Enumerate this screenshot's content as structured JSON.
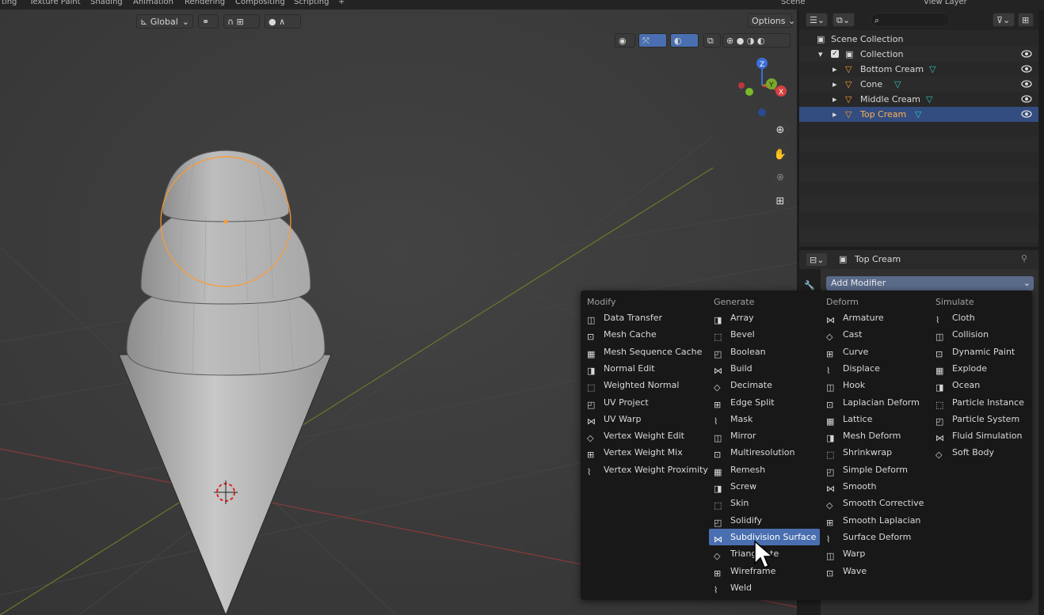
{
  "workspace_tabs": [
    "ting",
    "Texture Paint",
    "Shading",
    "Animation",
    "Rendering",
    "Compositing",
    "Scripting",
    "+"
  ],
  "top_right": {
    "scene": "Scene",
    "view_layer": "View Layer"
  },
  "viewport_header": {
    "transform_orientation": "Global",
    "options_label": "Options"
  },
  "gizmo_axes": {
    "z": "Z",
    "y": "Y",
    "x": "X"
  },
  "outliner": {
    "scene_collection": "Scene Collection",
    "collection": "Collection",
    "objects": [
      {
        "label": "Bottom Cream",
        "selected": false
      },
      {
        "label": "Cone",
        "selected": false
      },
      {
        "label": "Middle Cream",
        "selected": false
      },
      {
        "label": "Top Cream",
        "selected": true
      }
    ]
  },
  "properties": {
    "object_name": "Top Cream",
    "add_modifier": "Add Modifier"
  },
  "modifier_menu": {
    "columns": [
      {
        "heading": "Modify",
        "items": [
          "Data Transfer",
          "Mesh Cache",
          "Mesh Sequence Cache",
          "Normal Edit",
          "Weighted Normal",
          "UV Project",
          "UV Warp",
          "Vertex Weight Edit",
          "Vertex Weight Mix",
          "Vertex Weight Proximity"
        ]
      },
      {
        "heading": "Generate",
        "items": [
          "Array",
          "Bevel",
          "Boolean",
          "Build",
          "Decimate",
          "Edge Split",
          "Mask",
          "Mirror",
          "Multiresolution",
          "Remesh",
          "Screw",
          "Skin",
          "Solidify",
          "Subdivision Surface",
          "Triangulate",
          "Wireframe",
          "Weld"
        ]
      },
      {
        "heading": "Deform",
        "items": [
          "Armature",
          "Cast",
          "Curve",
          "Displace",
          "Hook",
          "Laplacian Deform",
          "Lattice",
          "Mesh Deform",
          "Shrinkwrap",
          "Simple Deform",
          "Smooth",
          "Smooth Corrective",
          "Smooth Laplacian",
          "Surface Deform",
          "Warp",
          "Wave"
        ]
      },
      {
        "heading": "Simulate",
        "items": [
          "Cloth",
          "Collision",
          "Dynamic Paint",
          "Explode",
          "Ocean",
          "Particle Instance",
          "Particle System",
          "Fluid Simulation",
          "Soft Body"
        ]
      }
    ],
    "highlighted": "Subdivision Surface"
  },
  "colors": {
    "accent": "#4a6fb0",
    "selection": "#ff9a2e",
    "outliner_selected": "#334d80"
  }
}
